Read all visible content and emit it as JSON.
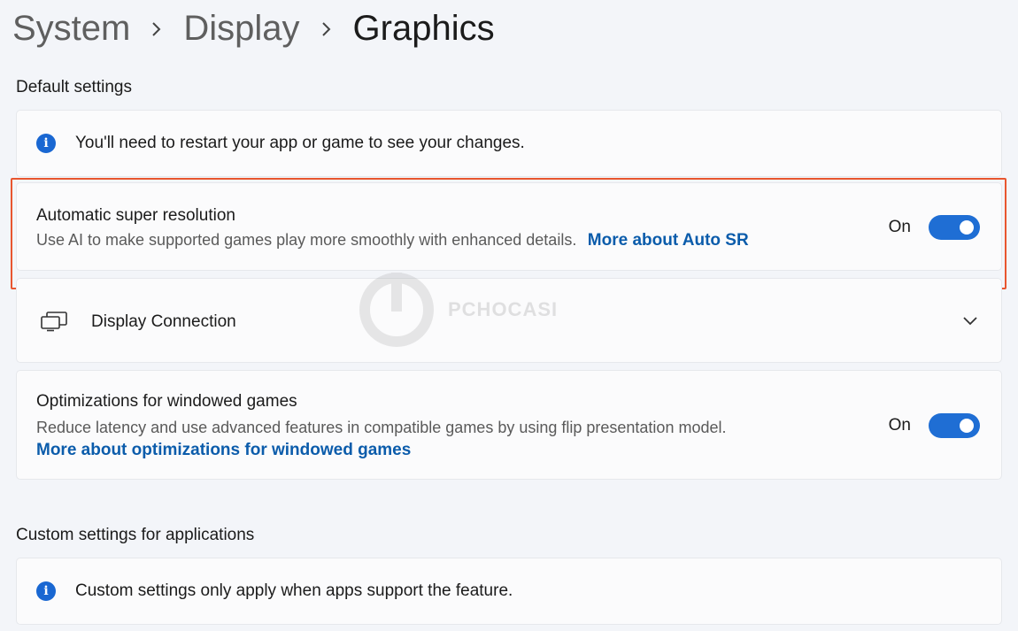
{
  "breadcrumb": {
    "items": [
      "System",
      "Display",
      "Graphics"
    ]
  },
  "default_settings": {
    "heading": "Default settings",
    "restart_notice": "You'll need to restart your app or game to see your changes.",
    "auto_sr": {
      "title": "Automatic super resolution",
      "description": "Use AI to make supported games play more smoothly with enhanced details.",
      "link": "More about Auto SR",
      "state_label": "On",
      "enabled": true
    },
    "display_connection": {
      "title": "Display Connection"
    },
    "windowed_games": {
      "title": "Optimizations for windowed games",
      "description": "Reduce latency and use advanced features in compatible games by using flip presentation model.",
      "link": "More about optimizations for windowed games",
      "state_label": "On",
      "enabled": true
    }
  },
  "custom_settings": {
    "heading": "Custom settings for applications",
    "notice": "Custom settings only apply when apps support the feature."
  },
  "watermark": {
    "text": "PCHOCASI"
  },
  "colors": {
    "accent": "#1f6ed4",
    "link": "#0b5cab",
    "highlight": "#e8562f",
    "background": "#f3f5f9"
  },
  "icons": {
    "chevron": "chevron-right-icon",
    "info": "info-icon",
    "monitor": "multi-monitor-icon",
    "expand": "chevron-down-icon"
  }
}
